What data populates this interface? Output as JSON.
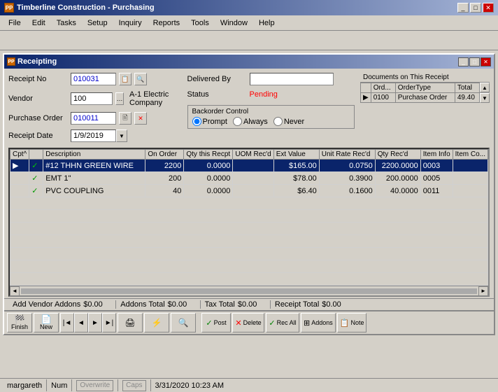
{
  "app": {
    "title": "Timberline Construction - Purchasing",
    "icon": "PP"
  },
  "menubar": {
    "items": [
      "File",
      "Edit",
      "Tasks",
      "Setup",
      "Inquiry",
      "Reports",
      "Tools",
      "Window",
      "Help"
    ]
  },
  "dialog": {
    "title": "Receipting",
    "receipt_no_label": "Receipt No",
    "receipt_no_value": "010031",
    "vendor_label": "Vendor",
    "vendor_id": "100",
    "vendor_name": "A-1 Electric Company",
    "po_label": "Purchase Order",
    "po_value": "010011",
    "date_label": "Receipt Date",
    "date_value": "1/9/2019",
    "delivered_by_label": "Delivered By",
    "delivered_by_value": "",
    "status_label": "Status",
    "status_value": "Pending",
    "backorder_label": "Backorder Control",
    "backorder_options": [
      "Prompt",
      "Always",
      "Never"
    ],
    "backorder_selected": "Prompt",
    "docs_header": "Documents on This Receipt",
    "docs_columns": [
      "Ord...",
      "OrderType",
      "Total"
    ],
    "docs_rows": [
      {
        "order": "0100",
        "type": "Purchase Order",
        "total": "49.40"
      }
    ]
  },
  "grid": {
    "columns": [
      "Cpt^",
      "",
      "Description",
      "On Order",
      "Qty this Recpt",
      "UOM Rec'd",
      "Ext Value",
      "Unit Rate Rec'd",
      "Qty Rec'd",
      "Item Info",
      "Item Co..."
    ],
    "rows": [
      {
        "selected": true,
        "arrow": "▶",
        "check": "✓",
        "description": "#12 THHN GREEN WIRE",
        "on_order": "2200",
        "qty_recpt": "0.0000",
        "uom": "",
        "ext_value": "$165.00",
        "unit_rate": "0.0750",
        "qty_recd": "2200.0000",
        "item_info": "0003"
      },
      {
        "selected": false,
        "arrow": "",
        "check": "✓",
        "description": "EMT 1\"",
        "on_order": "200",
        "qty_recpt": "0.0000",
        "uom": "",
        "ext_value": "$78.00",
        "unit_rate": "0.3900",
        "qty_recd": "200.0000",
        "item_info": "0005"
      },
      {
        "selected": false,
        "arrow": "",
        "check": "✓",
        "description": "PVC COUPLING",
        "on_order": "40",
        "qty_recpt": "0.0000",
        "uom": "",
        "ext_value": "$6.40",
        "unit_rate": "0.1600",
        "qty_recd": "40.0000",
        "item_info": "0011"
      }
    ]
  },
  "status_bottom": {
    "add_vendor_label": "Add Vendor Addons",
    "add_vendor_value": "$0.00",
    "addons_total_label": "Addons Total",
    "addons_total_value": "$0.00",
    "tax_total_label": "Tax Total",
    "tax_total_value": "$0.00",
    "receipt_total_label": "Receipt Total",
    "receipt_total_value": "$0.00"
  },
  "toolbar_bottom": {
    "finish_label": "Finish",
    "new_label": "New",
    "post_label": "Post",
    "delete_label": "Delete",
    "rec_all_label": "Rec All",
    "addons_label": "Addons",
    "note_label": "Note",
    "print_label": "Print",
    "search_label": "Search"
  },
  "very_bottom": {
    "user": "margareth",
    "num_label": "Num",
    "overwrite_label": "Overwrite",
    "caps_label": "Caps",
    "datetime": "3/31/2020 10:23 AM"
  }
}
